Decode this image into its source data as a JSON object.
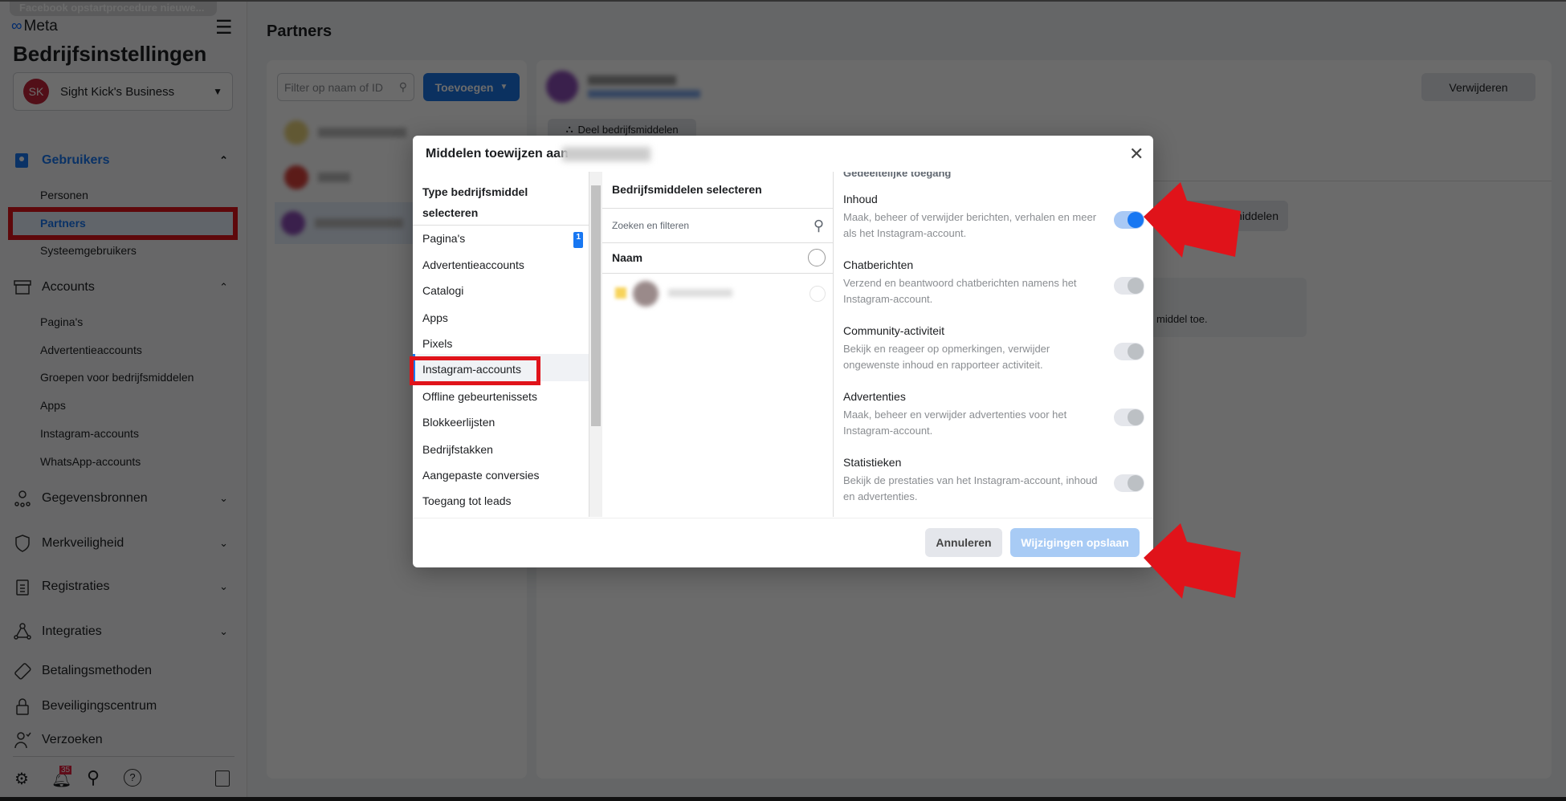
{
  "tooltip": "Facebook opstartprocedure nieuwe...",
  "logo": "Meta",
  "sidebar": {
    "title": "Bedrijfsinstellingen",
    "business": {
      "initials": "SK",
      "name": "Sight Kick's Business"
    },
    "gebruikers": {
      "label": "Gebruikers",
      "items": [
        "Personen",
        "Partners",
        "Systeemgebruikers"
      ]
    },
    "accounts": {
      "label": "Accounts",
      "items": [
        "Pagina's",
        "Advertentieaccounts",
        "Groepen voor bedrijfsmiddelen",
        "Apps",
        "Instagram-accounts",
        "WhatsApp-accounts"
      ]
    },
    "sections": [
      "Gegevensbronnen",
      "Merkveiligheid",
      "Registraties",
      "Integraties",
      "Betalingsmethoden",
      "Beveiligingscentrum",
      "Verzoeken"
    ],
    "notification_count": "35"
  },
  "main": {
    "title": "Partners",
    "filter_placeholder": "Filter op naam of ID",
    "add_label": "Toevoegen",
    "remove_label": "Verwijderen",
    "share_label": "Deel bedrijfsmiddelen",
    "assign_fragment": "ifsmiddelen",
    "empty_fragment": "middel toe."
  },
  "modal": {
    "title": "Middelen toewijzen aan",
    "col1": {
      "header": "Type bedrijfsmiddel selecteren",
      "items": [
        "Pagina's",
        "Advertentieaccounts",
        "Catalogi",
        "Apps",
        "Pixels",
        "Instagram-accounts",
        "Offline gebeurtenissets",
        "Blokkeerlijsten",
        "Bedrijfstakken",
        "Aangepaste conversies",
        "Toegang tot leads"
      ],
      "pages_badge": "1",
      "selected": "Instagram-accounts"
    },
    "col2": {
      "header": "Bedrijfsmiddelen selecteren",
      "search_placeholder": "Zoeken en filteren",
      "name_col": "Naam"
    },
    "col3": {
      "cut_header": "Gedeeltelijke toegang",
      "permissions": [
        {
          "title": "Inhoud",
          "desc": "Maak, beheer of verwijder berichten, verhalen en meer als het Instagram-account.",
          "enabled": true
        },
        {
          "title": "Chatberichten",
          "desc": "Verzend en beantwoord chatberichten namens het Instagram-account.",
          "enabled": false
        },
        {
          "title": "Community-activiteit",
          "desc": "Bekijk en reageer op opmerkingen, verwijder ongewenste inhoud en rapporteer activiteit.",
          "enabled": false
        },
        {
          "title": "Advertenties",
          "desc": "Maak, beheer en verwijder advertenties voor het Instagram-account.",
          "enabled": false
        },
        {
          "title": "Statistieken",
          "desc": "Bekijk de prestaties van het Instagram-account, inhoud en advertenties.",
          "enabled": false
        }
      ]
    },
    "cancel_label": "Annuleren",
    "save_label": "Wijzigingen opslaan"
  },
  "colors": {
    "accent": "#1877f2",
    "highlight": "#e0131a"
  }
}
